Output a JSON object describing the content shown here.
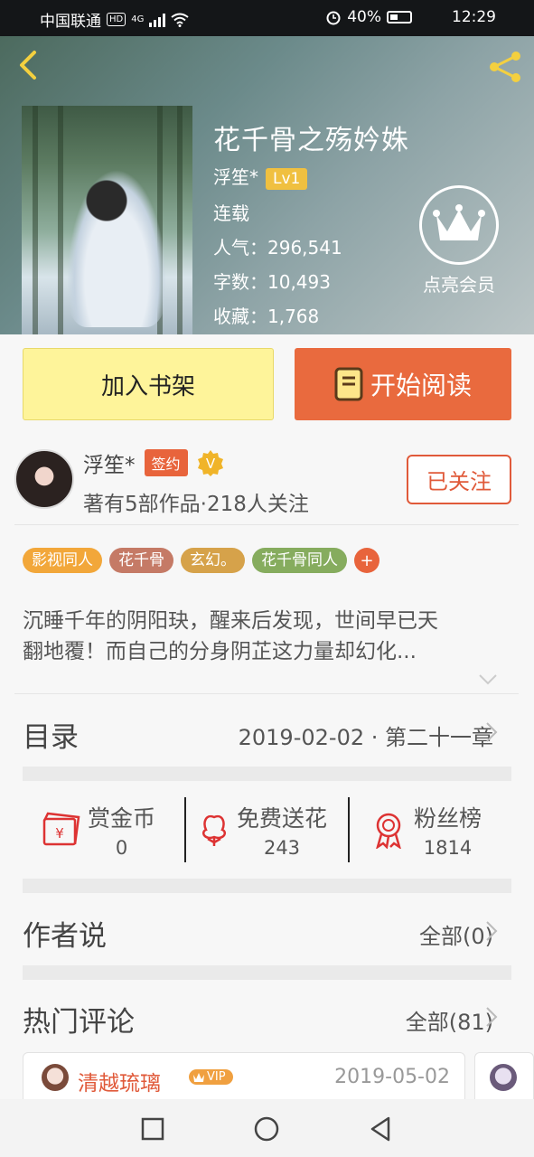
{
  "status_bar": {
    "carrier": "中国联通",
    "hd": "HD",
    "network": "4G",
    "battery": "40%",
    "time": "12:29"
  },
  "book": {
    "title": "花千骨之殇妗姝",
    "author": "浮笙*",
    "level": "Lv1",
    "status": "连载",
    "popularity_label": "人气：",
    "popularity": "296,541",
    "words_label": "字数：",
    "words": "10,493",
    "favorites_label": "收藏：",
    "favorites": "1,768"
  },
  "member": {
    "label": "点亮会员"
  },
  "actions": {
    "add_shelf": "加入书架",
    "start_read": "开始阅读"
  },
  "author": {
    "name": "浮笙*",
    "sign_badge": "签约",
    "verified": "V",
    "info": "著有5部作品·218人关注",
    "follow": "已关注"
  },
  "tags": [
    {
      "label": "影视同人",
      "color": "#f2a73a"
    },
    {
      "label": "花千骨",
      "color": "#c57a66"
    },
    {
      "label": "玄幻。",
      "color": "#d6a24a"
    },
    {
      "label": "花千骨同人",
      "color": "#86ac5e"
    }
  ],
  "tag_add": "+",
  "description": {
    "line1": "沉睡千年的阴阳玦，醒来后发现，世间早已天",
    "line2": "翻地覆！而自己的分身阴芷这力量却幻化..."
  },
  "catalog": {
    "label": "目录",
    "latest": "2019-02-02 · 第二十一章"
  },
  "stats": [
    {
      "label": "赏金币",
      "value": "0",
      "icon": "red-envelope-icon"
    },
    {
      "label": "免费送花",
      "value": "243",
      "icon": "flower-icon"
    },
    {
      "label": "粉丝榜",
      "value": "1814",
      "icon": "medal-icon"
    }
  ],
  "author_says": {
    "label": "作者说",
    "all": "全部(0)"
  },
  "hot_comments": {
    "label": "热门评论",
    "all": "全部(81)"
  },
  "comment": {
    "user": "清越琉璃",
    "vip": "VIP",
    "date": "2019-05-02"
  },
  "colors": {
    "accent": "#e96a3e",
    "shelf": "#fef49a",
    "follow": "#e05a3a",
    "gold": "#f0c040"
  }
}
